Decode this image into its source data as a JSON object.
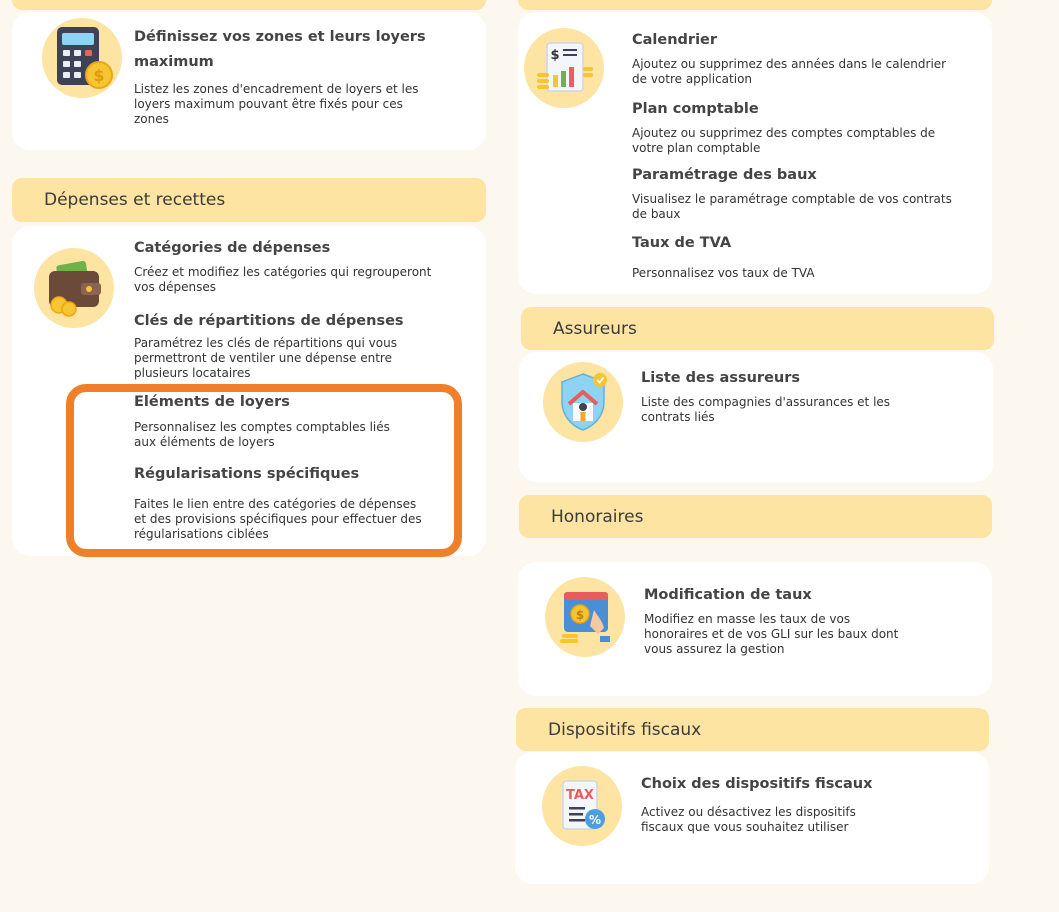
{
  "colors": {
    "page_background": "#fdf8ef",
    "section_band": "#fde4a3",
    "card": "#ffffff",
    "highlight": "#f07f2a"
  },
  "zones": {
    "title": "Définissez vos zones et leurs loyers maximum",
    "description": "Listez les zones d'encadrement de loyers et les loyers maximum pouvant être fixés pour ces zones",
    "icon": "calculator-icon"
  },
  "depenses": {
    "title": "Dépenses et recettes",
    "icon": "wallet-icon",
    "items": [
      {
        "title": "Catégories de dépenses",
        "description": "Créez et modifiez les catégories qui regrouperont vos dépenses"
      },
      {
        "title": "Clés de répartitions de dépenses",
        "description": "Paramétrez les clés de répartitions qui vous permettront de ventiler une dépense entre plusieurs locataires"
      },
      {
        "title": "Eléments de loyers",
        "description": "Personnalisez les comptes comptables liés aux éléments de loyers"
      },
      {
        "title": "Régularisations spécifiques",
        "description": "Faites le lien entre des catégories de dépenses et des provisions spécifiques pour effectuer des régularisations ciblées"
      }
    ]
  },
  "comptabilite": {
    "icon": "accounting-report-icon",
    "items": [
      {
        "title": "Calendrier",
        "description": "Ajoutez ou supprimez des années dans le calendrier de votre application"
      },
      {
        "title": "Plan comptable",
        "description": "Ajoutez ou supprimez des comptes comptables de votre plan comptable"
      },
      {
        "title": "Paramétrage des baux",
        "description": "Visualisez le paramétrage comptable de vos contrats de baux"
      },
      {
        "title": "Taux de TVA",
        "description": "Personnalisez vos taux de TVA"
      }
    ]
  },
  "assureurs": {
    "title": "Assureurs",
    "icon": "insured-house-icon",
    "item": {
      "title": "Liste des assureurs",
      "description": "Liste des compagnies d'assurances et les contrats liés"
    }
  },
  "honoraires": {
    "title": "Honoraires",
    "icon": "fee-rate-icon",
    "item": {
      "title": "Modification de taux",
      "description": "Modifiez en masse les taux de vos honoraires et de vos GLI sur les baux dont vous assurez la gestion"
    }
  },
  "fiscaux": {
    "title": "Dispositifs fiscaux",
    "icon": "tax-document-icon",
    "icon_text": "TAX",
    "item": {
      "title": "Choix des dispositifs fiscaux",
      "description": "Activez ou désactivez les dispositifs fiscaux que vous souhaitez utiliser"
    }
  }
}
